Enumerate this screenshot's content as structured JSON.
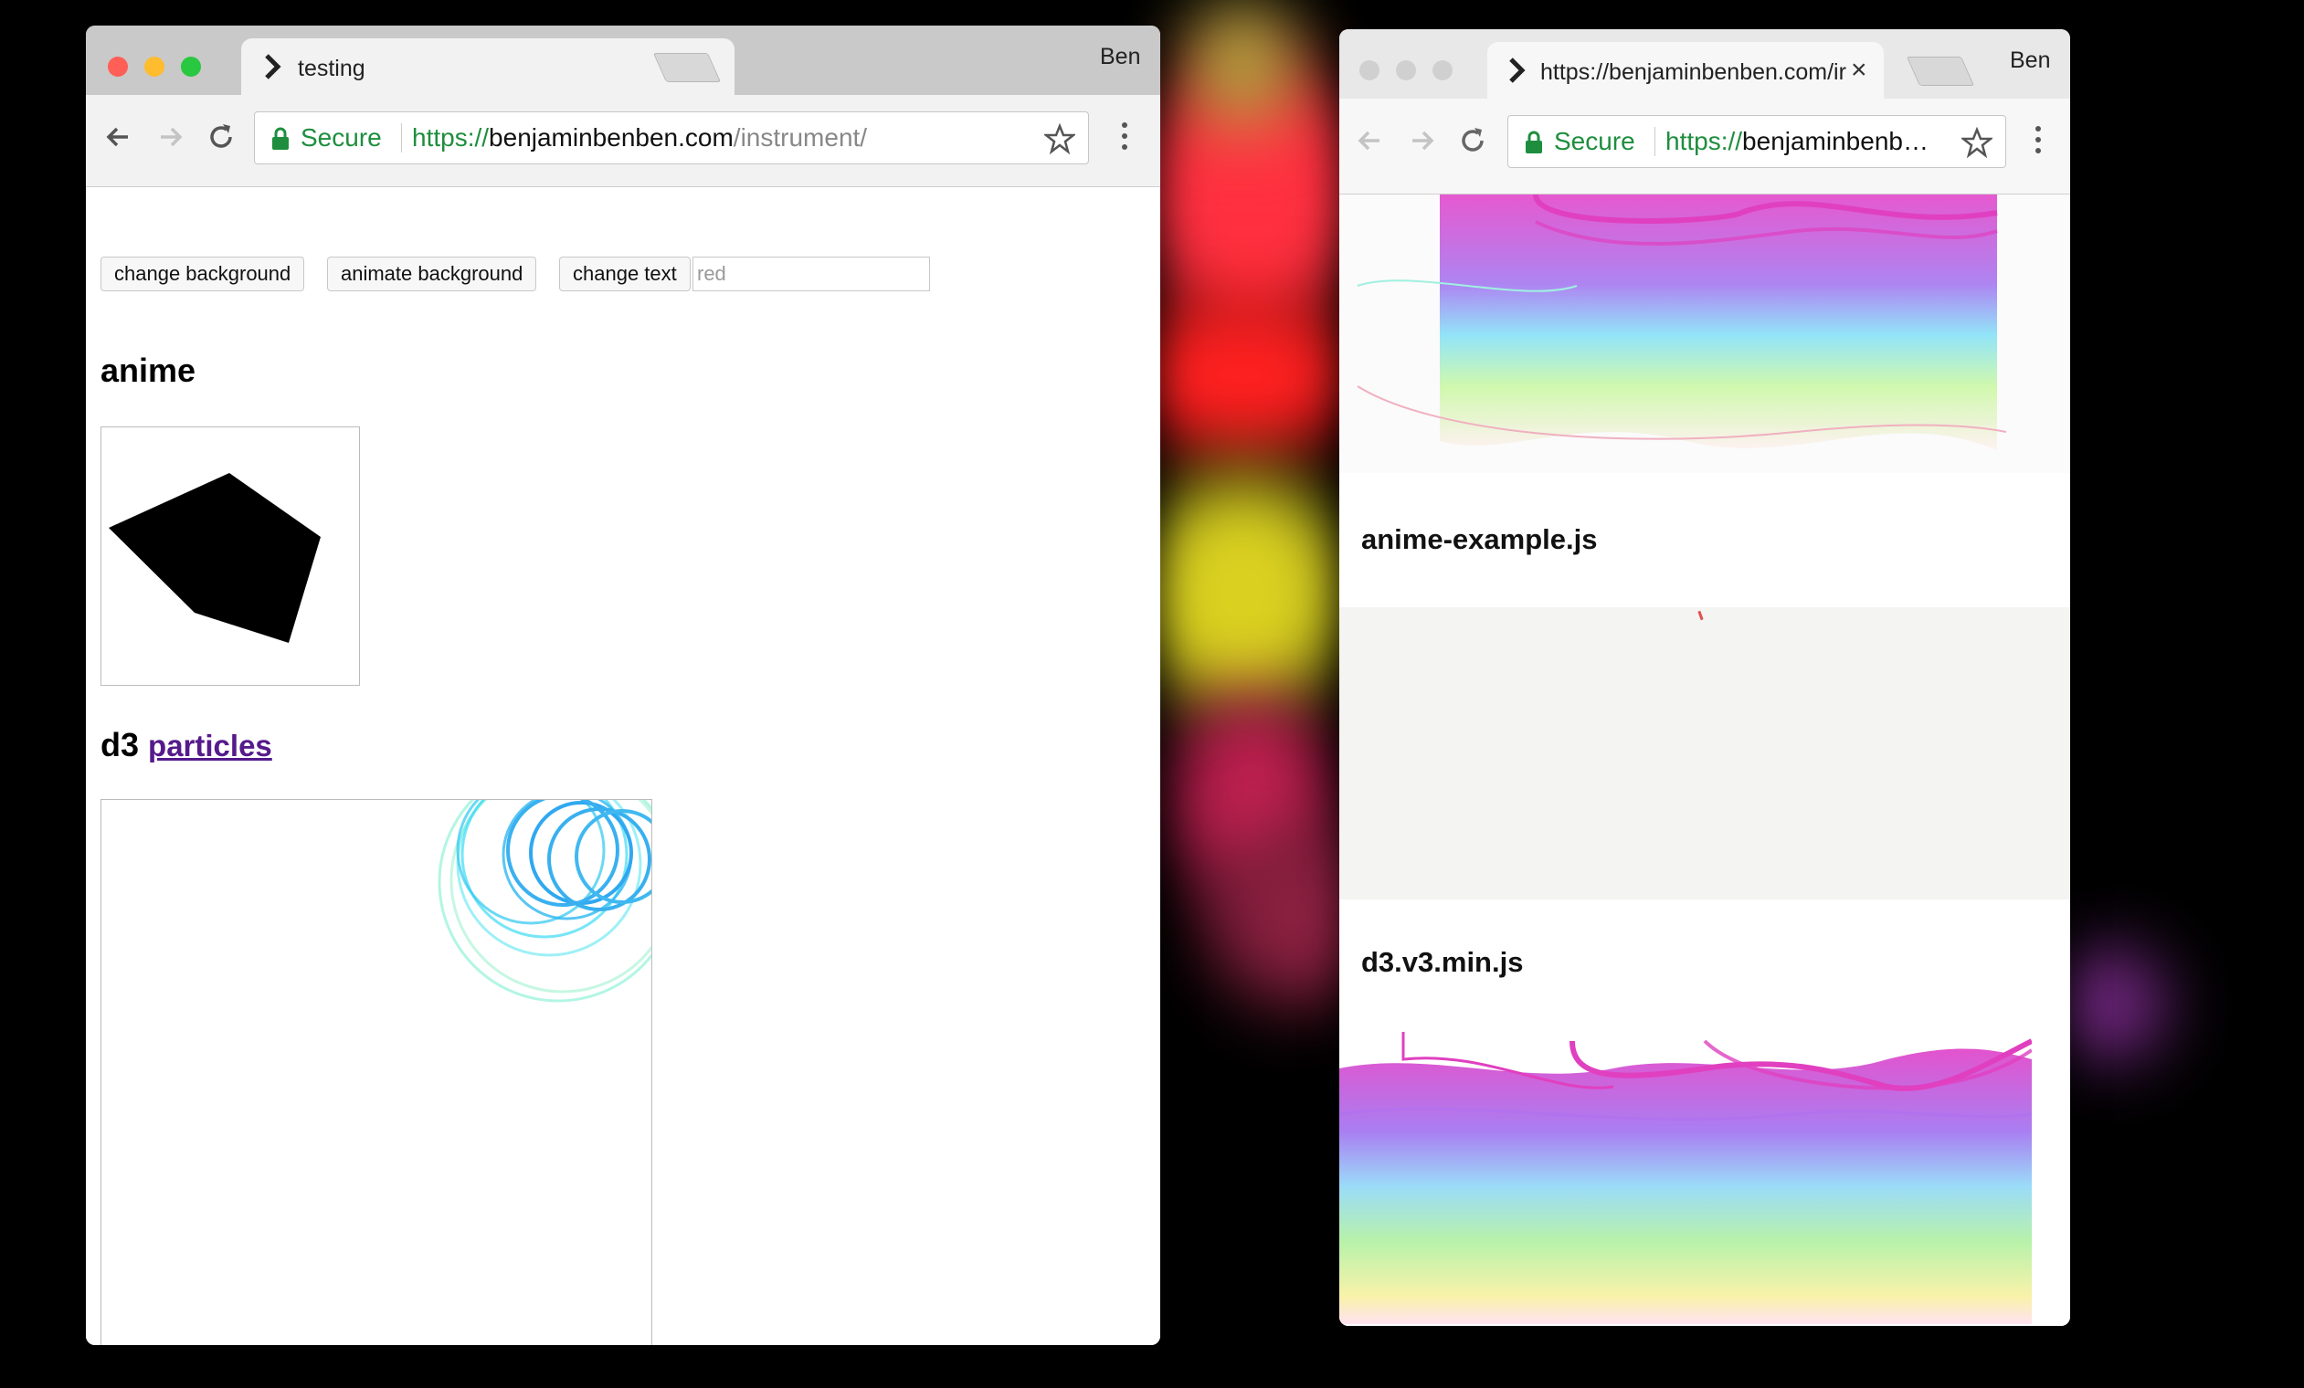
{
  "left_window": {
    "tab_title": "testing",
    "profile": "Ben",
    "secure_label": "Secure",
    "url_scheme": "https://",
    "url_domain": "benjaminbenben.com",
    "url_path": "/instrument/",
    "buttons": {
      "change_background": "change background",
      "animate_background": "animate background",
      "change_text": "change text"
    },
    "text_input_value": "red",
    "anime_heading": "anime",
    "d3_heading": "d3",
    "particles_link": "particles"
  },
  "right_window": {
    "tab_title": "https://benjaminbenben.com/ir",
    "profile": "Ben",
    "secure_label": "Secure",
    "url_scheme": "https://",
    "url_domain": "benjaminbenb…",
    "sections": {
      "anime_example": "anime-example.js",
      "d3_v3": "d3.v3.min.js"
    }
  },
  "icons": [
    "chevron-right-icon",
    "close-icon",
    "back-arrow-icon",
    "forward-arrow-icon",
    "reload-icon",
    "lock-icon",
    "star-icon",
    "menu-dots-icon"
  ],
  "colors": {
    "secure_green": "#1e8e3e",
    "link_visited": "#551a8b",
    "traffic_red": "#ff5f57",
    "traffic_yellow": "#febc2e",
    "traffic_green": "#28c840",
    "circle_cyan": "#2ec8f0",
    "wave_magenta": "#e040c0"
  }
}
